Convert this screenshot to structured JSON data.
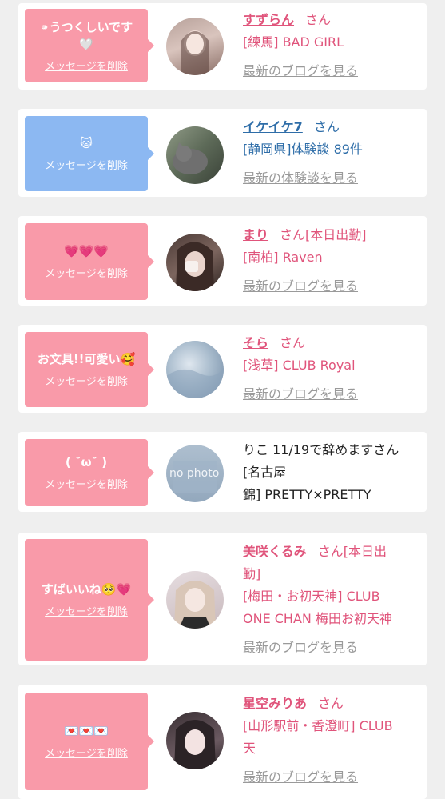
{
  "cards": [
    {
      "message": "うつくしいです",
      "delete_label": "メッセージを削除",
      "name": "すずらん",
      "san": "さん",
      "area": "[練馬] BAD GIRL",
      "link": "最新のブログを見る"
    },
    {
      "message": "🐱",
      "delete_label": "メッセージを削除",
      "name": "イケイケ7",
      "san": "さん",
      "area": "[静岡県]体験談 89件",
      "link": "最新の体験談を見る"
    },
    {
      "message": "💗💗💗",
      "delete_label": "メッセージを削除",
      "name": "まり",
      "san": "さん",
      "status": "[本日出勤]",
      "area": "[南柏] Raven",
      "link": "最新のブログを見る"
    },
    {
      "message": "お文具!!可愛い🥰",
      "delete_label": "メッセージを削除",
      "name": "そら",
      "san": "さん",
      "area": "[浅草] CLUB Royal",
      "link": "最新のブログを見る"
    },
    {
      "message": "( ˘ω˘ )",
      "delete_label": "メッセージを削除",
      "name_plain": "りこ 11/19で辞めますさん",
      "area_line1": "[名古屋",
      "area_line2": "錦] PRETTY×PRETTY",
      "avatar_text": "no photo"
    },
    {
      "message": "すばいいね🥺💗",
      "delete_label": "メッセージを削除",
      "name": "美咲くるみ",
      "san": "さん",
      "status_line1": "[本日出",
      "status_line2": "勤]",
      "area_line1": "[梅田・お初天神] CLUB",
      "area_line2": "ONE CHAN 梅田お初天神",
      "link": "最新のブログを見る"
    },
    {
      "message": "💌💌💌",
      "delete_label": "メッセージを削除",
      "name": "星空みりあ",
      "san": "さん",
      "area_line1": "[山形駅前・香澄町] CLUB",
      "area_line2": "天",
      "link": "最新のブログを見る"
    }
  ],
  "colors": {
    "pink_bubble": "#f99aa9",
    "blue_bubble": "#8cb8f2",
    "pink_text": "#e0547b",
    "blue_text": "#2e6da8"
  }
}
